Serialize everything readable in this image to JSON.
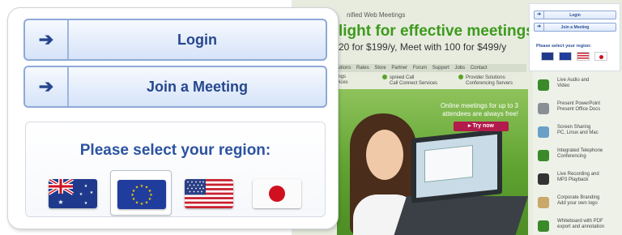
{
  "website": {
    "tagline": "nified Web Meetings",
    "headline": "light for effective meetings",
    "pricing": "20 for $199/y, Meet with 100 for $499/y",
    "nav": [
      "lutions",
      "Rates",
      "Store",
      "Partner",
      "Forum",
      "Support",
      "Jobs",
      "Contact"
    ],
    "features": [
      {
        "line1": "ings",
        "line2": "vices"
      },
      {
        "line1": "spreed Call",
        "line2": "Call Connect Services"
      },
      {
        "line1": "Provider Solutions",
        "line2": "Conferencing Servers"
      }
    ],
    "hero": {
      "text": "Online meetings for up to 3 attendees are always free!",
      "cta": "Try now"
    },
    "sidebar_features": [
      {
        "line1": "Live Audio and",
        "line2": "Video",
        "color": "#3a8a2a"
      },
      {
        "line1": "Present PowerPoint",
        "line2": "Present Office Docs",
        "color": "#8a8f96"
      },
      {
        "line1": "Screen Sharing",
        "line2": "PC, Linux and Mac",
        "color": "#6aa0c8"
      },
      {
        "line1": "Integrated Telephone",
        "line2": "Conferencing",
        "color": "#3a8a2a"
      },
      {
        "line1": "Live Recording and",
        "line2": "MP3 Playback",
        "color": "#333333"
      },
      {
        "line1": "Corporate Branding",
        "line2": "Add your own logo",
        "color": "#c9a86a"
      },
      {
        "line1": "Whiteboard with PDF",
        "line2": "export and annotation",
        "color": "#3a8a2a"
      }
    ],
    "mini_panel": {
      "login_label": "Login",
      "join_label": "Join a Meeting",
      "region_title": "Please select your region:"
    }
  },
  "panel": {
    "login_label": "Login",
    "join_label": "Join a Meeting",
    "arrow_glyph": "➔",
    "region_title": "Please select your region:",
    "regions": [
      {
        "name": "Australia",
        "flag": "australia-flag",
        "selected": false
      },
      {
        "name": "Europe",
        "flag": "eu-flag",
        "selected": true
      },
      {
        "name": "United States",
        "flag": "us-flag",
        "selected": false
      },
      {
        "name": "Japan",
        "flag": "japan-flag",
        "selected": false
      }
    ]
  },
  "colors": {
    "button_text": "#26478e",
    "region_title": "#2b53a0",
    "headline_green": "#3d9a1d",
    "cta_red": "#b21b4b"
  }
}
